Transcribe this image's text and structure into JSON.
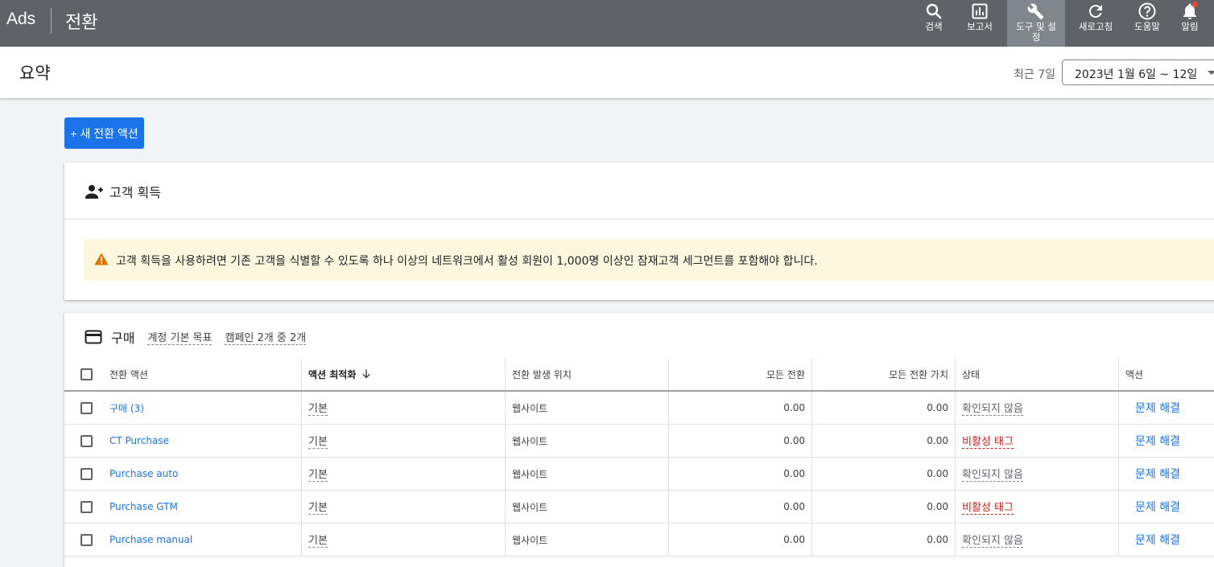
{
  "topbar": {
    "brand": "Ads",
    "section": "전환",
    "items": [
      {
        "label": "검색",
        "icon": "search-icon"
      },
      {
        "label": "보고서",
        "icon": "reports-icon"
      },
      {
        "label": "도구 및 설정",
        "icon": "wrench-icon"
      },
      {
        "label": "새로고침",
        "icon": "refresh-icon"
      },
      {
        "label": "도움말",
        "icon": "help-icon"
      },
      {
        "label": "알림",
        "icon": "bell-icon"
      }
    ]
  },
  "subheader": {
    "title": "요약",
    "range_label": "최근 7일",
    "date_range": "2023년 1월 6일 ~ 12일"
  },
  "new_button": "+ 새 전환 액션",
  "customer_acquisition": {
    "title": "고객 획득",
    "warning": "고객 획득을 사용하려면 기존 고객을 식별할 수 있도록 하나 이상의 네트워크에서 활성 회원이 1,000명 이상인 잠재고객 세그먼트를 포함해야 합니다."
  },
  "purchase": {
    "title": "구매",
    "goal_label": "계정 기본 목표",
    "campaign_label": "캠페인 2개 중 2개",
    "columns": [
      "전환 액션",
      "액션 최적화",
      "전환 발생 위치",
      "모든 전환",
      "모든 전환 가치",
      "상태",
      "액션"
    ],
    "rows": [
      {
        "name": "구매 (3)",
        "optimization": "기본",
        "source": "웹사이트",
        "conversions": "0.00",
        "value": "0.00",
        "status": "확인되지 않음",
        "status_type": "unverified",
        "action": "문제 해결"
      },
      {
        "name": "CT Purchase",
        "optimization": "기본",
        "source": "웹사이트",
        "conversions": "0.00",
        "value": "0.00",
        "status": "비활성 태그",
        "status_type": "inactive",
        "action": "문제 해결"
      },
      {
        "name": "Purchase auto",
        "optimization": "기본",
        "source": "웹사이트",
        "conversions": "0.00",
        "value": "0.00",
        "status": "확인되지 않음",
        "status_type": "unverified",
        "action": "문제 해결"
      },
      {
        "name": "Purchase GTM",
        "optimization": "기본",
        "source": "웹사이트",
        "conversions": "0.00",
        "value": "0.00",
        "status": "비활성 태그",
        "status_type": "inactive",
        "action": "문제 해결"
      },
      {
        "name": "Purchase manual",
        "optimization": "기본",
        "source": "웹사이트",
        "conversions": "0.00",
        "value": "0.00",
        "status": "확인되지 않음",
        "status_type": "unverified",
        "action": "문제 해결"
      }
    ]
  }
}
